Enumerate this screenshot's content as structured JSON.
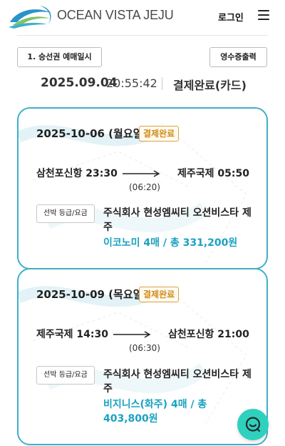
{
  "header": {
    "brand": "OCEAN VISTA JEJU",
    "login": "로그인",
    "logo_icon": "wave-logo-icon",
    "menu_icon": "hamburger-menu-icon"
  },
  "actions": {
    "reservation_date": "1. 승선권 예매일시",
    "receipt": "영수증출력"
  },
  "payment": {
    "date": "2025.09.04",
    "time": "20:55:42",
    "status": "결제완료(카드)"
  },
  "tickets": [
    {
      "date": "2025-10-06 (월요일)",
      "status": "결제완료",
      "departure": "삼천포신항 23:30",
      "arrival": "제주국제 05:50",
      "duration": "(06:20)",
      "grade_button": "선박 등급/요금",
      "company": "주식회사 현성엠씨티 오션비스타 제주",
      "fare": "이코노미 4매 / 총 331,200원"
    },
    {
      "date": "2025-10-09 (목요일)",
      "status": "결제완료",
      "departure": "제주국제 14:30",
      "arrival": "삼천포신항 21:00",
      "duration": "(06:30)",
      "grade_button": "선박 등급/요금",
      "company": "주식회사 현성엠씨티 오션비스타 제주",
      "fare": "비지니스(화주) 4매 / 총 403,800원"
    }
  ],
  "chat_icon": "chat-bubble-icon",
  "colors": {
    "accent": "#3fb0c8",
    "fare_text": "#1aa2c0",
    "badge": "#d08b1a",
    "chat_button": "#2ed1bd"
  }
}
